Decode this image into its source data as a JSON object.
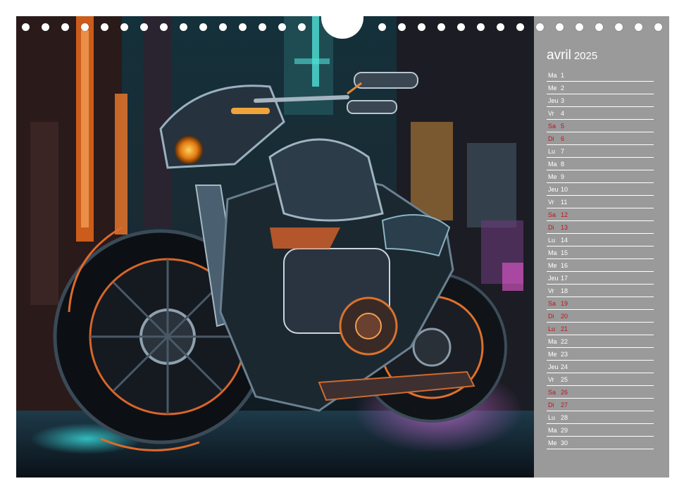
{
  "calendar": {
    "month": "avril",
    "year": "2025",
    "days": [
      {
        "name": "Ma",
        "date": "1",
        "weekend": false
      },
      {
        "name": "Me",
        "date": "2",
        "weekend": false
      },
      {
        "name": "Jeu",
        "date": "3",
        "weekend": false
      },
      {
        "name": "Vr",
        "date": "4",
        "weekend": false
      },
      {
        "name": "Sa",
        "date": "5",
        "weekend": true
      },
      {
        "name": "Di",
        "date": "6",
        "weekend": true
      },
      {
        "name": "Lu",
        "date": "7",
        "weekend": false
      },
      {
        "name": "Ma",
        "date": "8",
        "weekend": false
      },
      {
        "name": "Me",
        "date": "9",
        "weekend": false
      },
      {
        "name": "Jeu",
        "date": "10",
        "weekend": false
      },
      {
        "name": "Vr",
        "date": "11",
        "weekend": false
      },
      {
        "name": "Sa",
        "date": "12",
        "weekend": true
      },
      {
        "name": "Di",
        "date": "13",
        "weekend": true
      },
      {
        "name": "Lu",
        "date": "14",
        "weekend": false
      },
      {
        "name": "Ma",
        "date": "15",
        "weekend": false
      },
      {
        "name": "Me",
        "date": "16",
        "weekend": false
      },
      {
        "name": "Jeu",
        "date": "17",
        "weekend": false
      },
      {
        "name": "Vr",
        "date": "18",
        "weekend": false
      },
      {
        "name": "Sa",
        "date": "19",
        "weekend": true
      },
      {
        "name": "Di",
        "date": "20",
        "weekend": true
      },
      {
        "name": "Lu",
        "date": "21",
        "weekend": true
      },
      {
        "name": "Ma",
        "date": "22",
        "weekend": false
      },
      {
        "name": "Me",
        "date": "23",
        "weekend": false
      },
      {
        "name": "Jeu",
        "date": "24",
        "weekend": false
      },
      {
        "name": "Vr",
        "date": "25",
        "weekend": false
      },
      {
        "name": "Sa",
        "date": "26",
        "weekend": true
      },
      {
        "name": "Di",
        "date": "27",
        "weekend": true
      },
      {
        "name": "Lu",
        "date": "28",
        "weekend": false
      },
      {
        "name": "Ma",
        "date": "29",
        "weekend": false
      },
      {
        "name": "Me",
        "date": "30",
        "weekend": false
      }
    ]
  },
  "colors": {
    "sidebar": "#9a9a9a",
    "text": "#ffffff",
    "weekend": "#c0141a"
  }
}
